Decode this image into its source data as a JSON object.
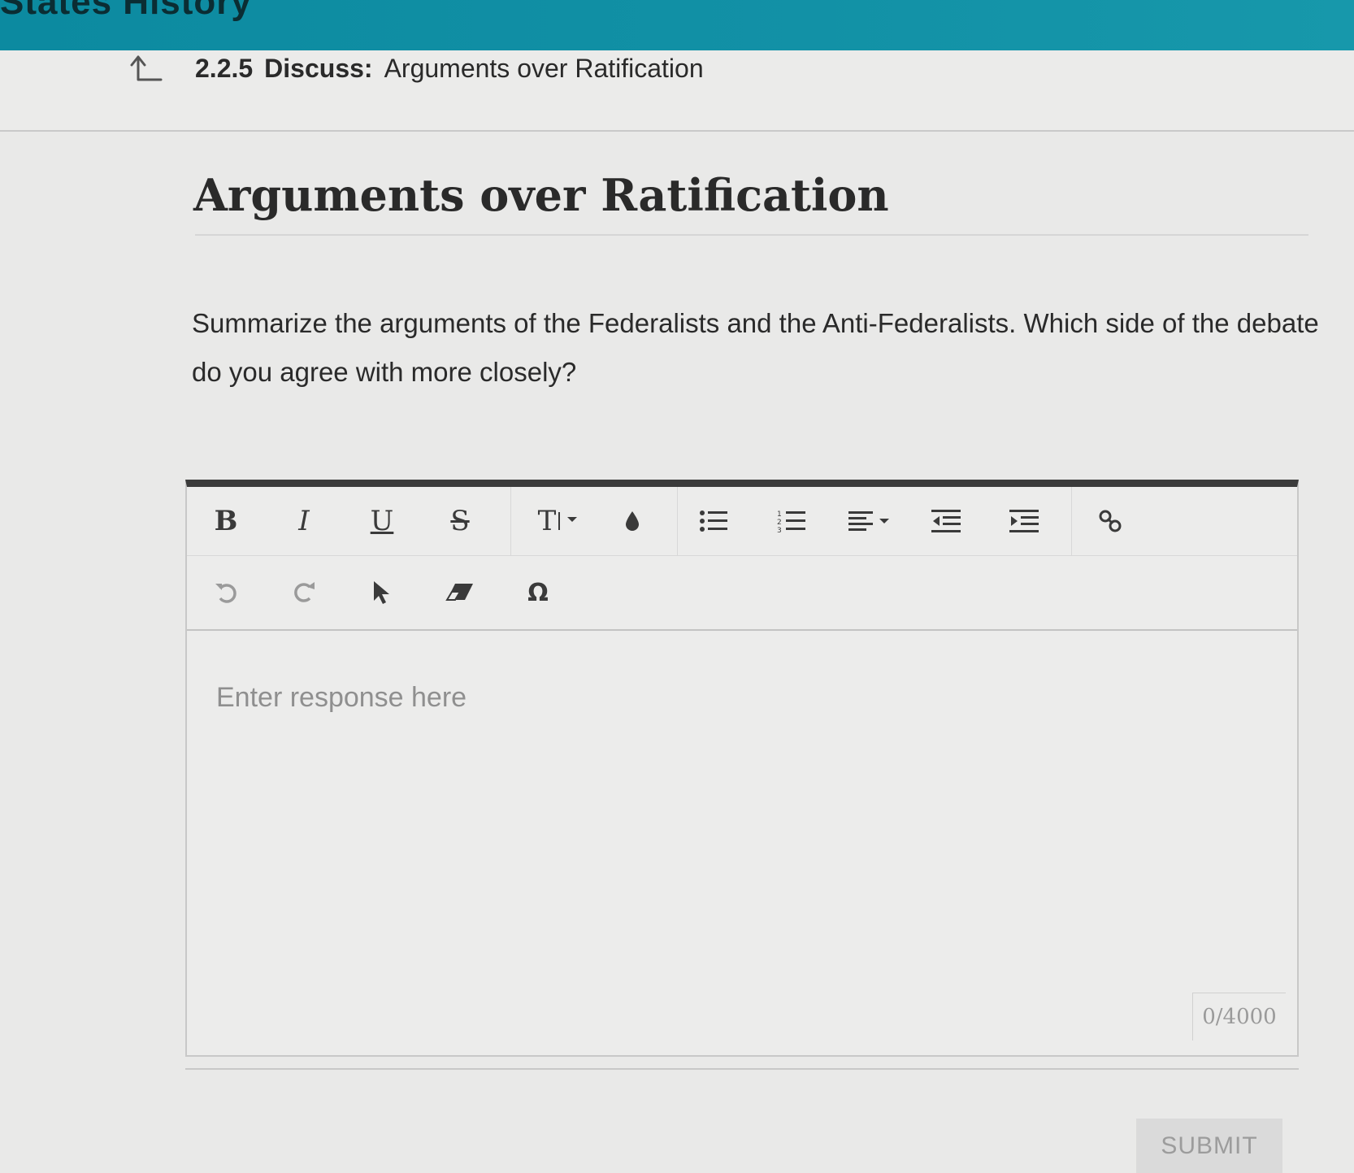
{
  "header": {
    "course_title": "States History"
  },
  "breadcrumb": {
    "number": "2.2.5",
    "kind": "Discuss:",
    "title": "Arguments over Ratification"
  },
  "page": {
    "title": "Arguments over Ratification",
    "prompt": "Summarize the arguments of the Federalists and the Anti-Federalists. Which side of the debate do you agree with more closely?"
  },
  "editor": {
    "toolbar": {
      "bold_label": "B",
      "italic_label": "I",
      "underline_label": "U",
      "strike_label": "S",
      "text_size_label": "T",
      "special_char_label": "Ω"
    },
    "response": {
      "value": "",
      "placeholder": "Enter response here"
    },
    "char_count": "0/4000"
  },
  "actions": {
    "submit_label": "SUBMIT"
  },
  "icons": {
    "back": "back-arrow-icon",
    "color": "text-color-drop-icon",
    "bullets": "bulleted-list-icon",
    "numbers": "numbered-list-icon",
    "align": "align-icon",
    "outdent": "outdent-icon",
    "indent": "indent-icon",
    "link": "link-icon",
    "undo": "undo-icon",
    "redo": "redo-icon",
    "select": "cursor-icon",
    "eraser": "eraser-icon"
  },
  "colors": {
    "header_teal": "#1291a6",
    "toolbar_top_border": "#3b3b3b",
    "submit_disabled_bg": "#dadada"
  }
}
